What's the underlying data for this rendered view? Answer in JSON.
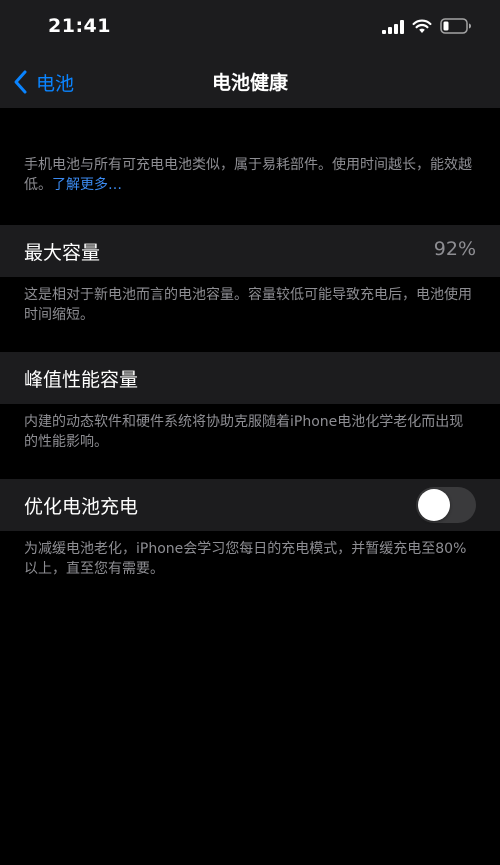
{
  "status_bar": {
    "time": "21:41",
    "icons": [
      "signal-icon",
      "wifi-icon",
      "battery-icon"
    ]
  },
  "nav": {
    "back_label": "电池",
    "title": "电池健康"
  },
  "intro": {
    "text": "手机电池与所有可充电电池类似，属于易耗部件。使用时间越长，能效越低。",
    "link": "了解更多…"
  },
  "max_capacity": {
    "label": "最大容量",
    "value": "92%",
    "footer": "这是相对于新电池而言的电池容量。容量较低可能导致充电后，电池使用时间缩短。"
  },
  "peak_performance": {
    "label": "峰值性能容量",
    "footer": "内建的动态软件和硬件系统将协助克服随着iPhone电池化学老化而出现的性能影响。"
  },
  "optimized_charging": {
    "label": "优化电池充电",
    "toggle_on": false,
    "footer": "为减缓电池老化，iPhone会学习您每日的充电模式，并暂缓充电至80%以上，直至您有需要。"
  },
  "colors": {
    "background": "#000000",
    "cell_background": "#1c1c1e",
    "accent": "#0a84ff",
    "secondary_text": "#8e8e93",
    "toggle_off": "#3a3a3c"
  }
}
